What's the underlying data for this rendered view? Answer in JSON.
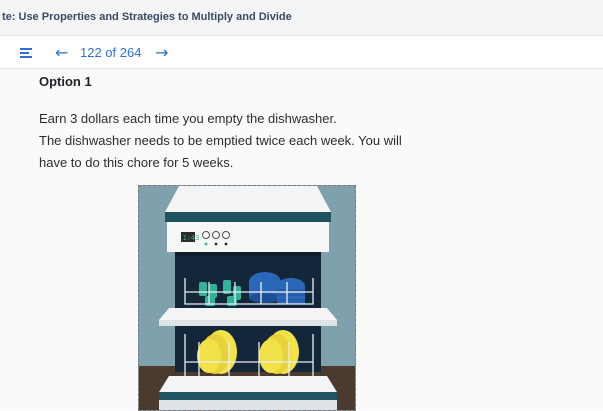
{
  "window": {
    "title": "te: Use Properties and Strategies to Multiply and Divide"
  },
  "navbar": {
    "page_indicator": "122 of 264",
    "back_icon": "arrow-left-icon",
    "forward_icon": "arrow-right-icon",
    "menu_icon": "menu-icon"
  },
  "content": {
    "option_title": "Option 1",
    "paragraph_lines": [
      "Earn 3 dollars each time you empty the dishwasher.",
      "The dishwasher needs to be emptied twice each week. You will",
      "have to do this chore for 5 weeks."
    ],
    "image": {
      "subject": "dishwasher-illustration",
      "display_text": "1:43"
    }
  },
  "colors": {
    "accent": "#2f6fd6",
    "title_text": "#3b4a63",
    "wall": "#7fa0ad",
    "floor": "#4a3a30",
    "dish_green": "#2fb39a",
    "dish_blue": "#2a67b8",
    "dish_yellow": "#f2e24a"
  }
}
